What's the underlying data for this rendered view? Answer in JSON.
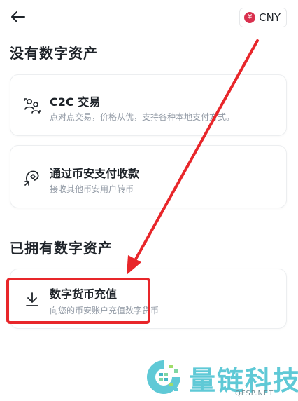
{
  "header": {
    "currency_symbol": "¥",
    "currency_code": "CNY"
  },
  "sections": {
    "no_assets_title": "没有数字资产",
    "has_assets_title": "已拥有数字资产"
  },
  "cards": [
    {
      "title": "C2C 交易",
      "desc": "点对点交易，价格从优，支持各种本地支付方式。",
      "icon": "c2c-users-icon"
    },
    {
      "title": "通过币安支付收款",
      "desc": "接收其他币安用户转币",
      "icon": "pay-receive-icon"
    },
    {
      "title": "数字货币充值",
      "desc": "向您的币安账户充值数字货币",
      "icon": "deposit-download-icon"
    }
  ],
  "watermark": {
    "name": "量链科技",
    "domain": "QFSP.NET"
  },
  "colors": {
    "highlight": "#e8262a",
    "currency_badge": "#d9304e",
    "watermark": "#5fc9d6"
  }
}
